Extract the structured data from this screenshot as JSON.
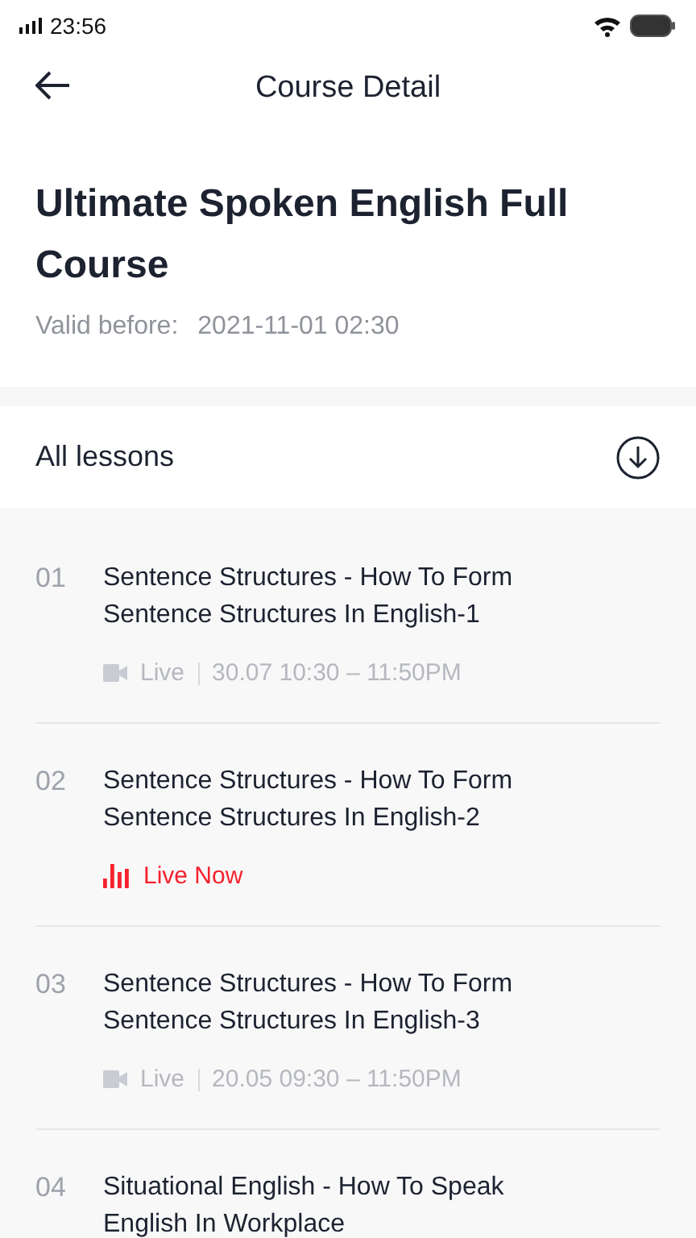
{
  "status_bar": {
    "time": "23:56"
  },
  "header": {
    "title": "Course Detail"
  },
  "course": {
    "title": "Ultimate Spoken English Full Course",
    "valid_label": "Valid before:",
    "valid_date": "2021-11-01 02:30"
  },
  "lessons_header": {
    "title": "All lessons"
  },
  "lessons": [
    {
      "number": "01",
      "title": "Sentence Structures - How To Form Sentence Structures In English-1",
      "kind": "scheduled",
      "status": "Live",
      "time": "30.07 10:30 – 11:50PM"
    },
    {
      "number": "02",
      "title": "Sentence Structures - How To Form Sentence Structures In English-2",
      "kind": "live_now",
      "status": "Live Now"
    },
    {
      "number": "03",
      "title": "Sentence Structures - How To Form Sentence Structures In English-3",
      "kind": "scheduled",
      "status": "Live",
      "time": "20.05 09:30 – 11:50PM"
    },
    {
      "number": "04",
      "title": "Situational English - How To Speak English In Workplace",
      "kind": "none"
    }
  ]
}
